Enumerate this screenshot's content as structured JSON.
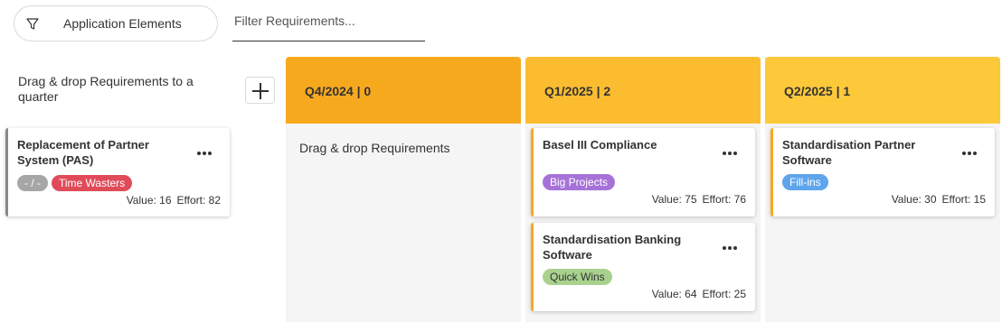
{
  "toolbar": {
    "filter_button_label": "Application Elements",
    "filter_icon": "funnel-icon",
    "search_placeholder": "Filter Requirements..."
  },
  "backlog": {
    "instructions": "Drag & drop Requirements to a quarter",
    "add_icon": "plus-icon",
    "card": {
      "title": "Replacement of Partner System (PAS)",
      "tags": [
        {
          "label": "- / -",
          "color": "#a6a6a6"
        },
        {
          "label": "Time Wasters",
          "color": "#e04b5a"
        }
      ],
      "value_text": "Value: 16",
      "effort_text": "Effort: 82",
      "accent": "#888888"
    }
  },
  "columns": [
    {
      "title": "Q4/2024 | 0",
      "color": "#f7a91e",
      "placeholder": "Drag & drop Requirements",
      "cards": []
    },
    {
      "title": "Q1/2025 | 2",
      "color": "#fbbd2f",
      "placeholder": "",
      "cards": [
        {
          "title": "Basel III Compliance",
          "tag": {
            "label": "Big Projects",
            "color": "#a772d8"
          },
          "value_text": "Value: 75",
          "effort_text": "Effort: 76",
          "accent": "#f7a91e"
        },
        {
          "title": "Standardisation Banking Software",
          "tag": {
            "label": "Quick Wins",
            "color": "#a9d18e",
            "text_color": "#333333"
          },
          "value_text": "Value: 64",
          "effort_text": "Effort: 25",
          "accent": "#f7a91e"
        }
      ]
    },
    {
      "title": "Q2/2025 | 1",
      "color": "#fdc93a",
      "placeholder": "",
      "cards": [
        {
          "title": "Standardisation Partner Software",
          "tag": {
            "label": "Fill-ins",
            "color": "#5ea5ec"
          },
          "value_text": "Value: 30",
          "effort_text": "Effort: 15",
          "accent": "#f7a91e"
        }
      ]
    }
  ],
  "more_icon": "more-horizontal-icon"
}
